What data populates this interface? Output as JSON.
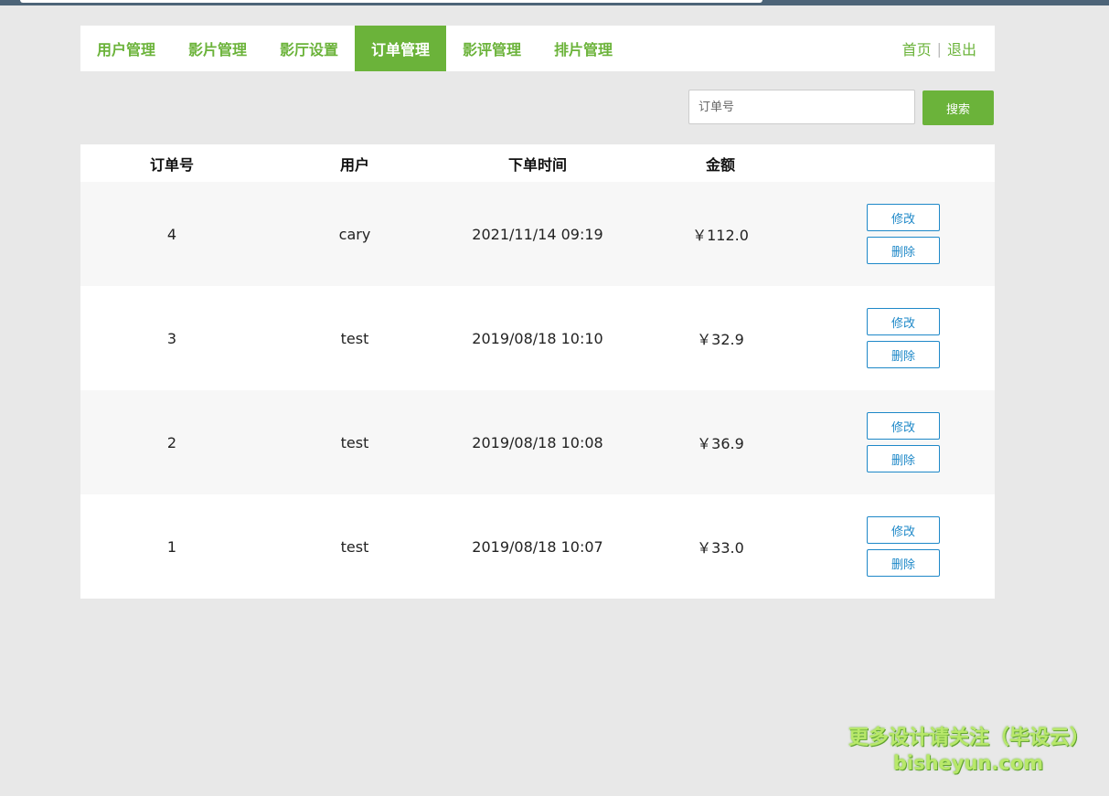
{
  "nav": {
    "items": [
      {
        "label": "用户管理",
        "active": false
      },
      {
        "label": "影片管理",
        "active": false
      },
      {
        "label": "影厅设置",
        "active": false
      },
      {
        "label": "订单管理",
        "active": true
      },
      {
        "label": "影评管理",
        "active": false
      },
      {
        "label": "排片管理",
        "active": false
      }
    ],
    "home": "首页",
    "separator": "|",
    "logout": "退出"
  },
  "search": {
    "placeholder": "订单号",
    "value": "",
    "button": "搜索"
  },
  "table": {
    "headers": [
      "订单号",
      "用户",
      "下单时间",
      "金额",
      ""
    ],
    "rows": [
      {
        "id": "4",
        "user": "cary",
        "time": "2021/11/14 09:19",
        "amount": "￥112.0"
      },
      {
        "id": "3",
        "user": "test",
        "time": "2019/08/18 10:10",
        "amount": "￥32.9"
      },
      {
        "id": "2",
        "user": "test",
        "time": "2019/08/18 10:08",
        "amount": "￥36.9"
      },
      {
        "id": "1",
        "user": "test",
        "time": "2019/08/18 10:07",
        "amount": "￥33.0"
      }
    ],
    "edit_label": "修改",
    "delete_label": "删除"
  },
  "watermark": {
    "line1": "更多设计请关注（毕设云）",
    "line2": "bisheyun.com"
  },
  "colors": {
    "accent": "#6bb33a",
    "action_blue": "#1e88c8",
    "background": "#e8e8e8"
  }
}
